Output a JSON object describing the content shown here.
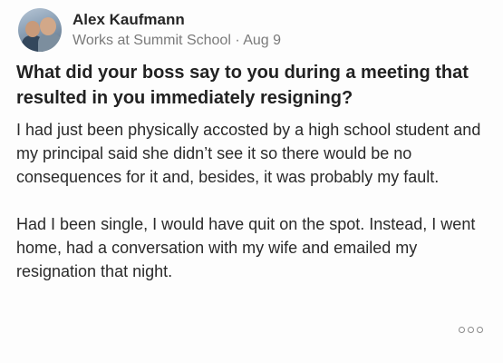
{
  "author": {
    "name": "Alex Kaufmann",
    "credential": "Works at Summit School",
    "separator": "·",
    "date": "Aug 9"
  },
  "question": "What did your boss say to you during a meeting that resulted in you immediately resigning?",
  "answer": {
    "paragraphs": [
      "I had just been physically accosted by a high school student and my principal said she didn’t see it so there would be no consequences for it and, besides, it was probably my fault.",
      "Had I been single, I would have quit on the spot. Instead, I went home, had a conversation with my wife and emailed my resignation that night."
    ]
  },
  "actions": {
    "more_icon": "more-options-icon"
  }
}
